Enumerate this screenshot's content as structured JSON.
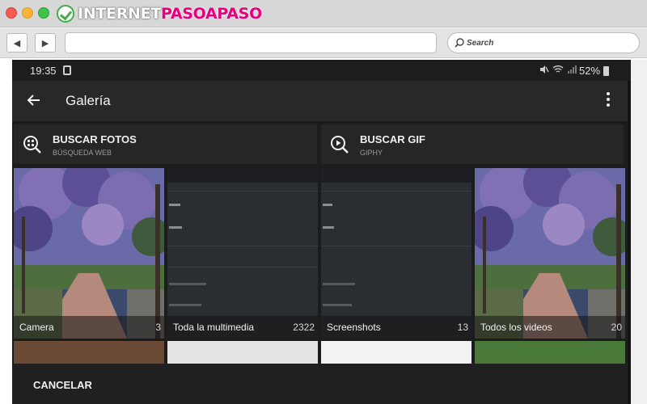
{
  "browser": {
    "logo_part1": "INTERNET",
    "logo_part2": "PASOAPASO",
    "back_icon": "◀",
    "forward_icon": "▶",
    "search_placeholder": "Search"
  },
  "statusbar": {
    "time": "19:35",
    "battery": "52%"
  },
  "appbar": {
    "title": "Galería"
  },
  "search_tiles": [
    {
      "title": "BUSCAR FOTOS",
      "subtitle": "BÚSQUEDA WEB",
      "icon": "image-search-icon"
    },
    {
      "title": "BUSCAR GIF",
      "subtitle": "GIPHY",
      "icon": "gif-search-icon"
    }
  ],
  "albums": [
    {
      "name": "Camera",
      "count": "3"
    },
    {
      "name": "Toda la multimedia",
      "count": "2322"
    },
    {
      "name": "Screenshots",
      "count": "13"
    },
    {
      "name": "Todos los videos",
      "count": "20"
    }
  ],
  "footer": {
    "cancel_label": "CANCELAR"
  },
  "colors": {
    "app_background": "#1c1c1c",
    "appbar": "#282828",
    "brand_green": "#3fae49",
    "brand_pink": "#e6007e"
  }
}
